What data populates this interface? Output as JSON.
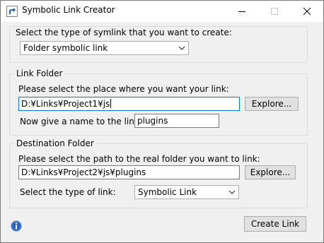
{
  "window": {
    "title": "Symbolic Link Creator",
    "caption_buttons": [
      "minimize",
      "maximize",
      "close"
    ]
  },
  "symlink_type": {
    "prompt": "Select the type of symlink that you want to create:",
    "selected": "Folder symbolic link"
  },
  "link_folder": {
    "group_title": "Link Folder",
    "place_prompt": "Please select the place where you want your link:",
    "path_value": "D:¥Links¥Project1¥js",
    "explore_label": "Explore...",
    "name_prompt": "Now give a name to the link:",
    "name_value": "plugins"
  },
  "destination_folder": {
    "group_title": "Destination Folder",
    "path_prompt": "Please select the path to the real folder you want to link:",
    "path_value": "D:¥Links¥Project2¥js¥plugins",
    "explore_label": "Explore...",
    "link_type_prompt": "Select the type of link:",
    "link_type_selected": "Symbolic Link"
  },
  "footer": {
    "create_label": "Create Link",
    "info_icon": "info-icon"
  },
  "colors": {
    "window_bg": "#f0f0f0",
    "titlebar_bg": "#ffffff",
    "focus_border": "#0078d7",
    "button_bg": "#e1e1e1",
    "info_blue": "#2c5fb8"
  }
}
